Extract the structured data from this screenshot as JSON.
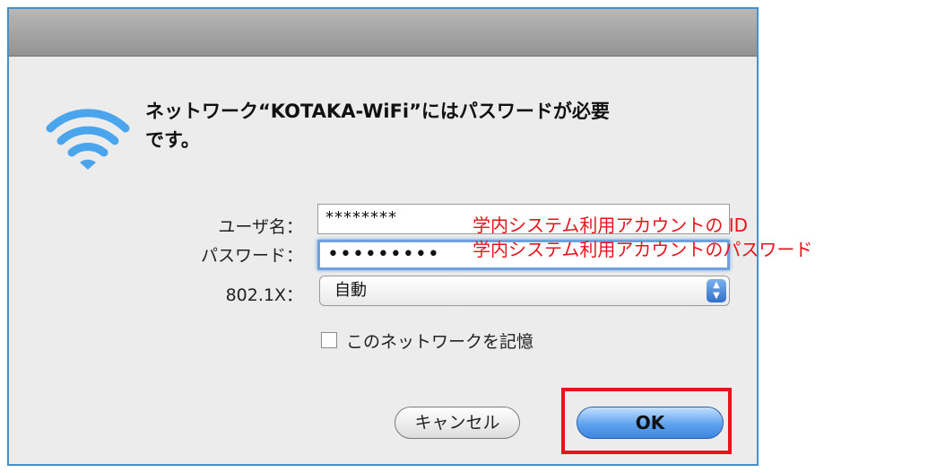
{
  "dialog": {
    "message": "ネットワーク“KOTAKA-WiFi”にはパスワードが必要\nです。",
    "username_label": "ユーザ名：",
    "username_value": "********",
    "password_label": "パスワード：",
    "password_value": "•••••••••",
    "dot1x_label": "802.1X：",
    "dot1x_value": "自動",
    "remember_label": "このネットワークを記憶",
    "cancel_label": "キャンセル",
    "ok_label": "OK"
  },
  "annotations": {
    "username_note": "学内システム利用アカウントの ID",
    "password_note": "学内システム利用アカウントのパスワード",
    "color": "#e8141c"
  },
  "icons": {
    "wifi": "wifi-icon",
    "select_arrows": "up-down-arrows-icon"
  },
  "colors": {
    "focus_ring": "#6ea2dd",
    "ok_button": "#5ea2ee"
  }
}
